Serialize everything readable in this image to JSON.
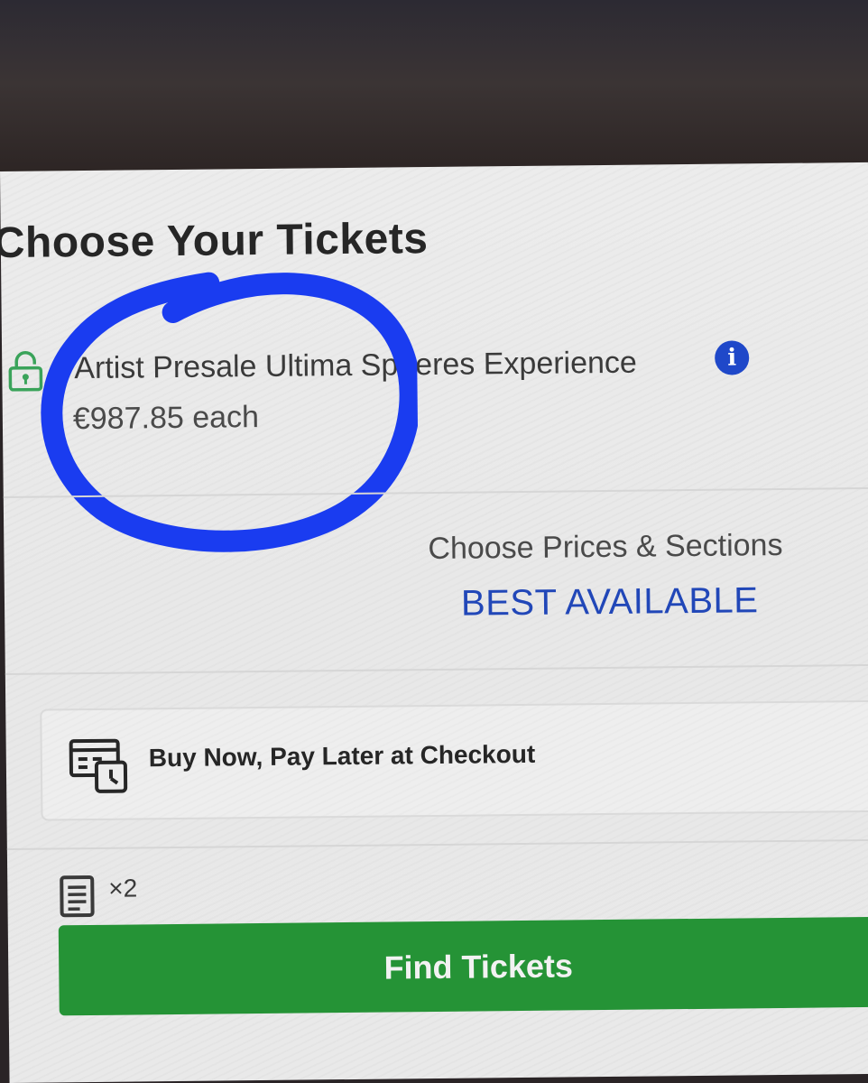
{
  "page": {
    "heading": "Choose Your Tickets"
  },
  "ticket": {
    "name": "Artist Presale Ultima    Spheres Experience",
    "price": "€987.85 each",
    "info_icon": "info-icon",
    "lock_icon": "lock-icon"
  },
  "prices": {
    "label": "Choose Prices & Sections",
    "value": "BEST AVAILABLE"
  },
  "payment": {
    "label": "Buy Now, Pay Later at Checkout",
    "icon": "calendar-clock-icon"
  },
  "quantity": {
    "value": "×2",
    "icon": "document-icon"
  },
  "actions": {
    "find_label": "Find Tickets"
  },
  "colors": {
    "accent_blue": "#2147b8",
    "button_green": "#259336",
    "annotation_circle": "#1a3cf0",
    "lock_green": "#3aa35a"
  }
}
